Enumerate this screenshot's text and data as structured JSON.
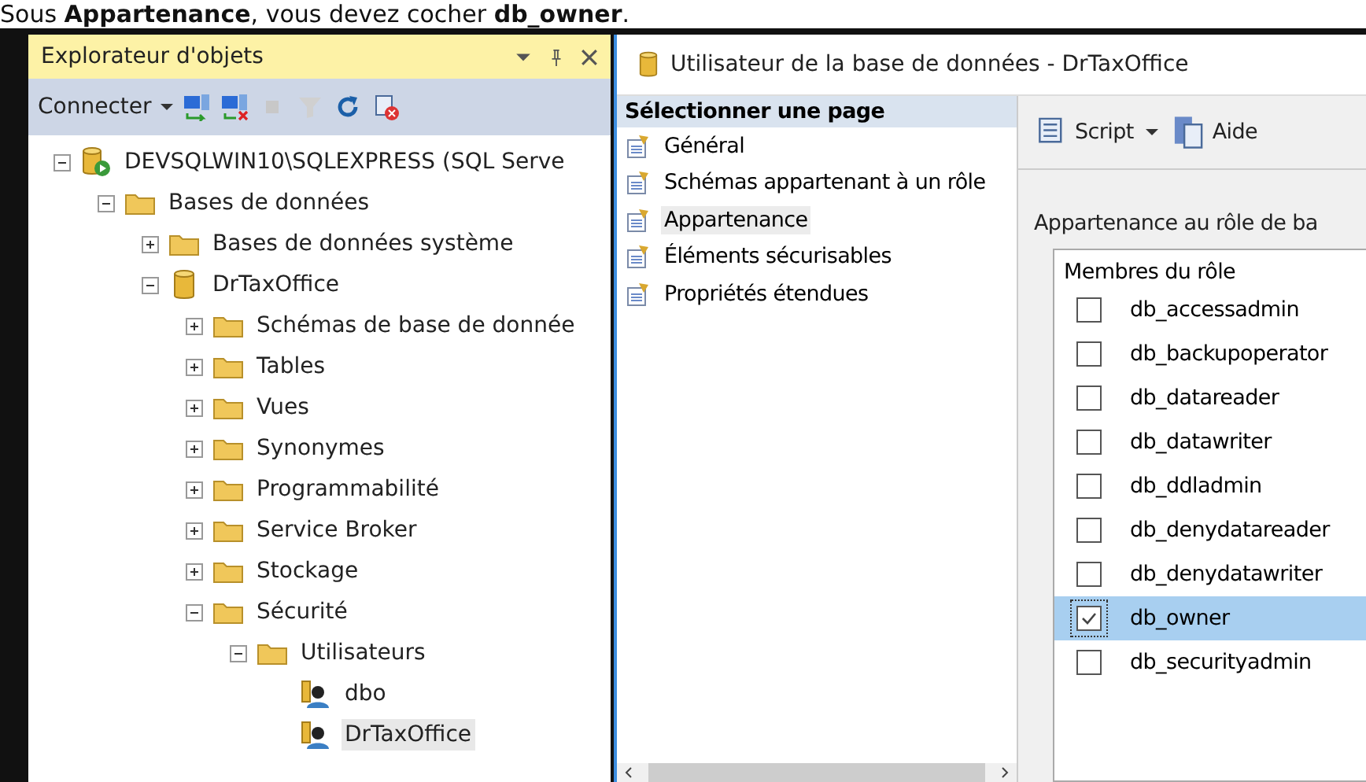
{
  "caption": "Sous **Appartenance**, vous devez cocher **db_owner**.",
  "object_explorer": {
    "title": "Explorateur d'objets",
    "connect_label": "Connecter",
    "tree": [
      {
        "label": "DEVSQLWIN10\\SQLEXPRESS (SQL Serve",
        "kind": "server",
        "expanded": true,
        "selected": false,
        "children": [
          {
            "label": "Bases de données",
            "kind": "folder",
            "expanded": true,
            "selected": false,
            "children": [
              {
                "label": "Bases de données système",
                "kind": "folder",
                "expanded": false,
                "selected": false
              },
              {
                "label": "DrTaxOffice",
                "kind": "database",
                "expanded": true,
                "selected": false,
                "children": [
                  {
                    "label": "Schémas de base de donnée",
                    "kind": "folder",
                    "expanded": false,
                    "selected": false
                  },
                  {
                    "label": "Tables",
                    "kind": "folder",
                    "expanded": false,
                    "selected": false
                  },
                  {
                    "label": "Vues",
                    "kind": "folder",
                    "expanded": false,
                    "selected": false
                  },
                  {
                    "label": "Synonymes",
                    "kind": "folder",
                    "expanded": false,
                    "selected": false
                  },
                  {
                    "label": "Programmabilité",
                    "kind": "folder",
                    "expanded": false,
                    "selected": false
                  },
                  {
                    "label": "Service Broker",
                    "kind": "folder",
                    "expanded": false,
                    "selected": false
                  },
                  {
                    "label": "Stockage",
                    "kind": "folder",
                    "expanded": false,
                    "selected": false
                  },
                  {
                    "label": "Sécurité",
                    "kind": "folder",
                    "expanded": true,
                    "selected": false,
                    "children": [
                      {
                        "label": "Utilisateurs",
                        "kind": "folder",
                        "expanded": true,
                        "selected": false,
                        "children": [
                          {
                            "label": "dbo",
                            "kind": "user",
                            "selected": false
                          },
                          {
                            "label": "DrTaxOffice",
                            "kind": "user",
                            "selected": true
                          }
                        ]
                      }
                    ]
                  }
                ]
              }
            ]
          }
        ]
      }
    ]
  },
  "dialog": {
    "title": "Utilisateur de la base de données - DrTaxOffice",
    "pages_header": "Sélectionner une page",
    "pages": [
      {
        "label": "Général",
        "selected": false
      },
      {
        "label": "Schémas appartenant à un rôle",
        "selected": false
      },
      {
        "label": "Appartenance",
        "selected": true
      },
      {
        "label": "Éléments sécurisables",
        "selected": false
      },
      {
        "label": "Propriétés étendues",
        "selected": false
      }
    ],
    "toolbar": {
      "script_label": "Script",
      "help_label": "Aide"
    },
    "group_label": "Appartenance au rôle de ba",
    "list_header": "Membres du rôle",
    "roles": [
      {
        "name": "db_accessadmin",
        "checked": false,
        "selected": false
      },
      {
        "name": "db_backupoperator",
        "checked": false,
        "selected": false
      },
      {
        "name": "db_datareader",
        "checked": false,
        "selected": false
      },
      {
        "name": "db_datawriter",
        "checked": false,
        "selected": false
      },
      {
        "name": "db_ddladmin",
        "checked": false,
        "selected": false
      },
      {
        "name": "db_denydatareader",
        "checked": false,
        "selected": false
      },
      {
        "name": "db_denydatawriter",
        "checked": false,
        "selected": false
      },
      {
        "name": "db_owner",
        "checked": true,
        "selected": true
      },
      {
        "name": "db_securityadmin",
        "checked": false,
        "selected": false
      }
    ]
  }
}
